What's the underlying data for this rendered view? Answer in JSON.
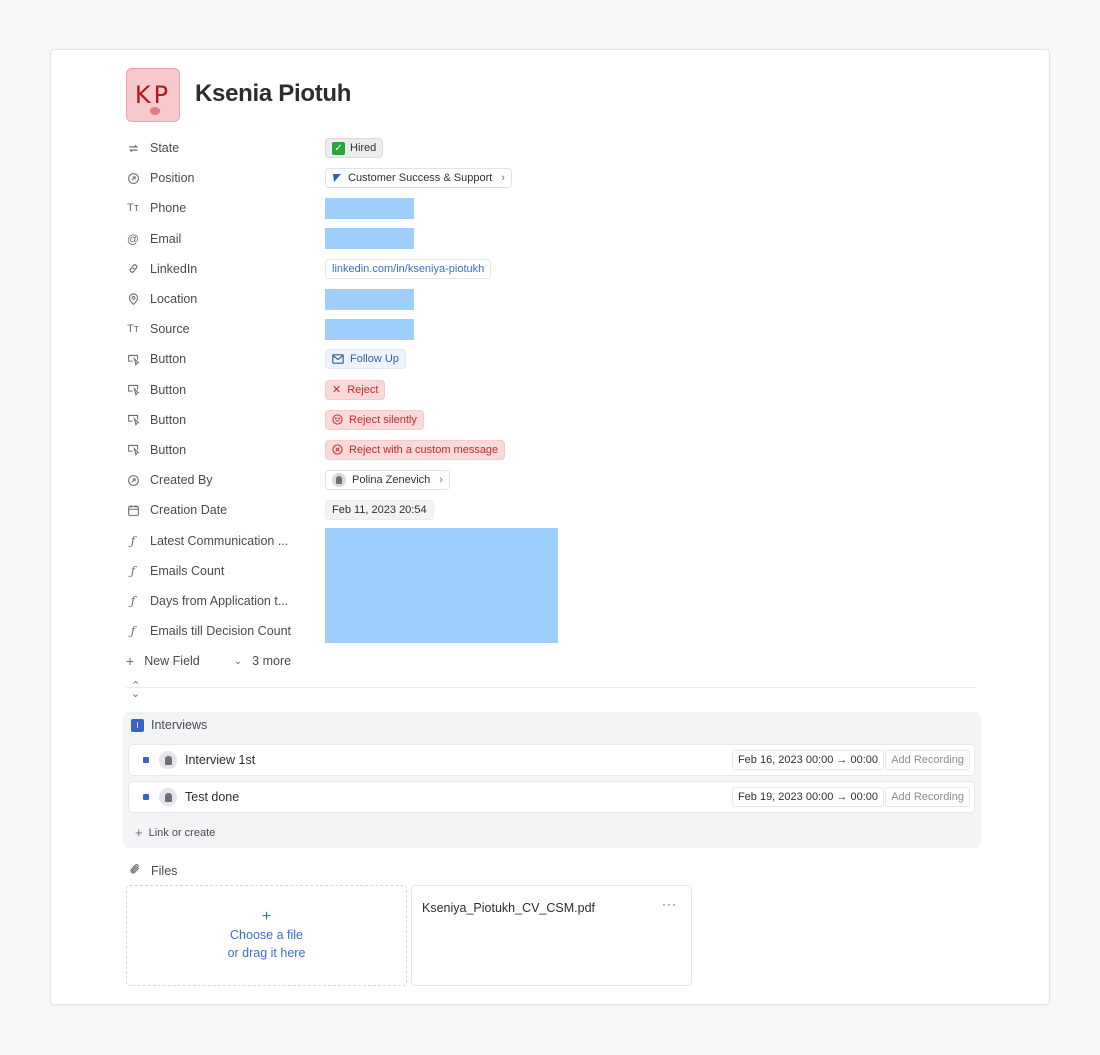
{
  "record": {
    "avatar_initials": "KP",
    "title": "Ksenia Piotuh"
  },
  "properties": [
    {
      "key": "state",
      "label": "State",
      "icon": "status-cycle-icon"
    },
    {
      "key": "position",
      "label": "Position",
      "icon": "relation-arrow-icon"
    },
    {
      "key": "phone",
      "label": "Phone",
      "icon": "text-type-icon"
    },
    {
      "key": "email",
      "label": "Email",
      "icon": "at-icon"
    },
    {
      "key": "linkedin",
      "label": "LinkedIn",
      "icon": "link-icon"
    },
    {
      "key": "location",
      "label": "Location",
      "icon": "map-pin-icon"
    },
    {
      "key": "source",
      "label": "Source",
      "icon": "text-type-icon"
    },
    {
      "key": "button1",
      "label": "Button",
      "icon": "cursor-click-icon"
    },
    {
      "key": "button2",
      "label": "Button",
      "icon": "cursor-click-icon"
    },
    {
      "key": "button3",
      "label": "Button",
      "icon": "cursor-click-icon"
    },
    {
      "key": "button4",
      "label": "Button",
      "icon": "cursor-click-icon"
    },
    {
      "key": "created_by",
      "label": "Created By",
      "icon": "relation-arrow-icon"
    },
    {
      "key": "creation_date",
      "label": "Creation Date",
      "icon": "calendar-icon"
    },
    {
      "key": "latest_comm",
      "label": "Latest Communication ...",
      "icon": "formula-icon"
    },
    {
      "key": "emails_count",
      "label": "Emails Count",
      "icon": "formula-icon"
    },
    {
      "key": "days_from_app",
      "label": "Days from Application t...",
      "icon": "formula-icon"
    },
    {
      "key": "emails_till_decision",
      "label": "Emails till Decision Count",
      "icon": "formula-icon"
    }
  ],
  "values": {
    "state": "Hired",
    "position": "Customer Success & Support",
    "linkedin": "linkedin.com/in/kseniya-piotukh",
    "follow_up": "Follow Up",
    "reject": "Reject",
    "reject_silently": "Reject silently",
    "reject_custom": "Reject with a custom message",
    "created_by": "Polina Zenevich",
    "creation_date": "Feb 11, 2023 20:54"
  },
  "footer_actions": {
    "new_field": "New Field",
    "more": "3 more"
  },
  "interviews": {
    "heading": "Interviews",
    "items": [
      {
        "name": "Interview 1st",
        "date": "Feb 16, 2023 00:00 → 00:00",
        "recording": "Add Recording"
      },
      {
        "name": "Test done",
        "date": "Feb 19, 2023 00:00 → 00:00",
        "recording": "Add Recording"
      }
    ],
    "link_or_create": "Link or create"
  },
  "files": {
    "heading": "Files",
    "dropzone_line1": "Choose a file",
    "dropzone_line2": "or drag it here",
    "file_name": "Kseniya_Piotukh_CV_CSM.pdf",
    "file_menu": "···"
  },
  "colors": {
    "accent_blue": "#3a6fc4",
    "danger_red": "#c42b2b",
    "redacted_fill": "#a0cffd"
  }
}
